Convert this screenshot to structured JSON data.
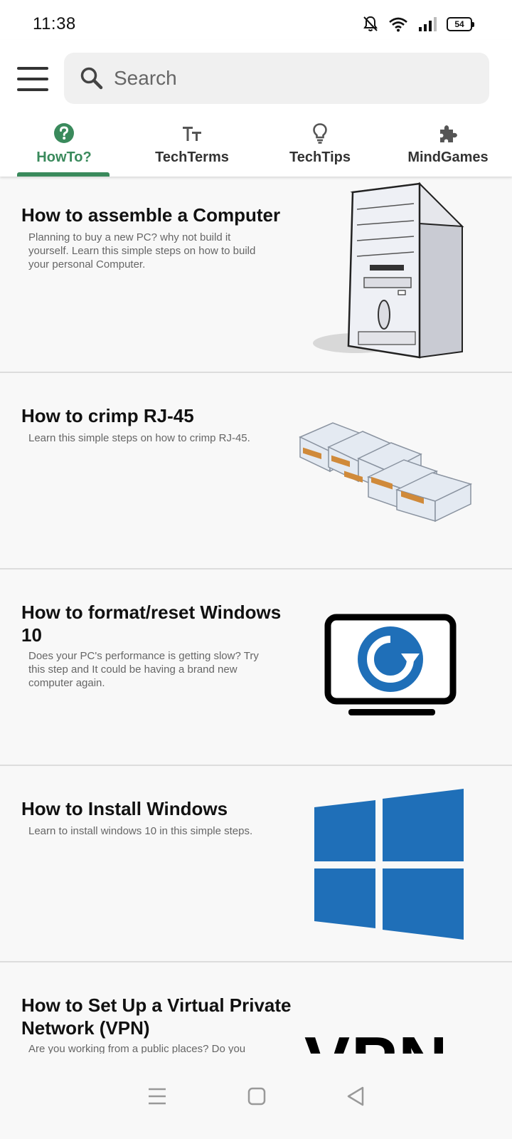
{
  "status": {
    "time": "11:38",
    "battery": "54"
  },
  "header": {
    "search_placeholder": "Search",
    "tabs": [
      {
        "label": "HowTo?",
        "icon": "help-circle-icon",
        "active": true
      },
      {
        "label": "TechTerms",
        "icon": "text-size-icon",
        "active": false
      },
      {
        "label": "TechTips",
        "icon": "lightbulb-icon",
        "active": false
      },
      {
        "label": "MindGames",
        "icon": "puzzle-icon",
        "active": false
      }
    ],
    "accent_color": "#3a8a5c"
  },
  "articles": [
    {
      "title": "How to assemble a Computer",
      "description": "Planning to buy a new PC? why not build it yourself. Learn this simple steps on how to build your personal Computer.",
      "image": "computer-tower-icon"
    },
    {
      "title": "How to crimp RJ-45",
      "description": "Learn this simple steps on how to crimp RJ-45.",
      "image": "rj45-connectors-icon"
    },
    {
      "title": "How to format/reset Windows 10",
      "description": "Does your PC's performance is getting slow? Try this step and It could be having a brand new computer again.",
      "image": "monitor-reset-icon"
    },
    {
      "title": "How to Install Windows",
      "description": "Learn to install windows 10 in this simple steps.",
      "image": "windows-logo-icon"
    },
    {
      "title": "How to Set Up a Virtual Private Network (VPN)",
      "description": "Are you working from a public places? Do you",
      "image": "vpn-text-icon",
      "image_text": "VPN"
    }
  ]
}
